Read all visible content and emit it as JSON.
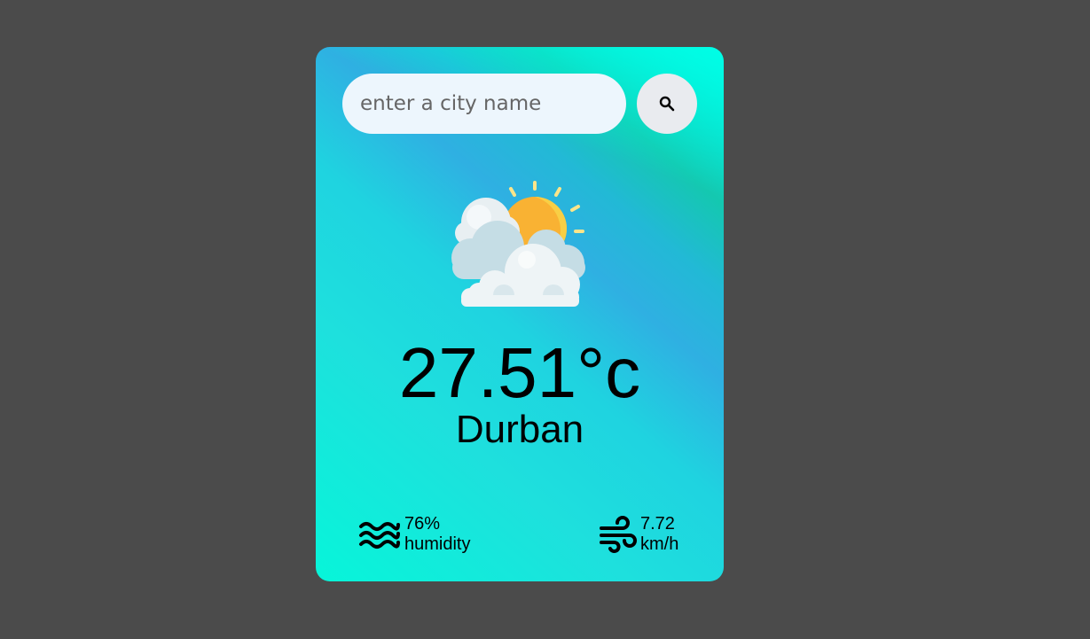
{
  "search": {
    "placeholder": "enter a city name",
    "value": ""
  },
  "weather": {
    "icon": "partly-cloudy-icon",
    "temperature": "27.51°c",
    "city": "Durban"
  },
  "humidity": {
    "icon": "humidity-waves-icon",
    "value": "76%",
    "label": "humidity"
  },
  "wind": {
    "icon": "wind-icon",
    "value": "7.72",
    "unit": "km/h"
  },
  "colors": {
    "background": "#4b4b4b",
    "card_gradient": [
      "#07f5d9",
      "#2fb0e2",
      "#00efe3"
    ],
    "input_bg": "#edf6fd",
    "button_bg": "#e9ebef",
    "sun": "#f9b233",
    "cloud": "#eef5f8"
  }
}
